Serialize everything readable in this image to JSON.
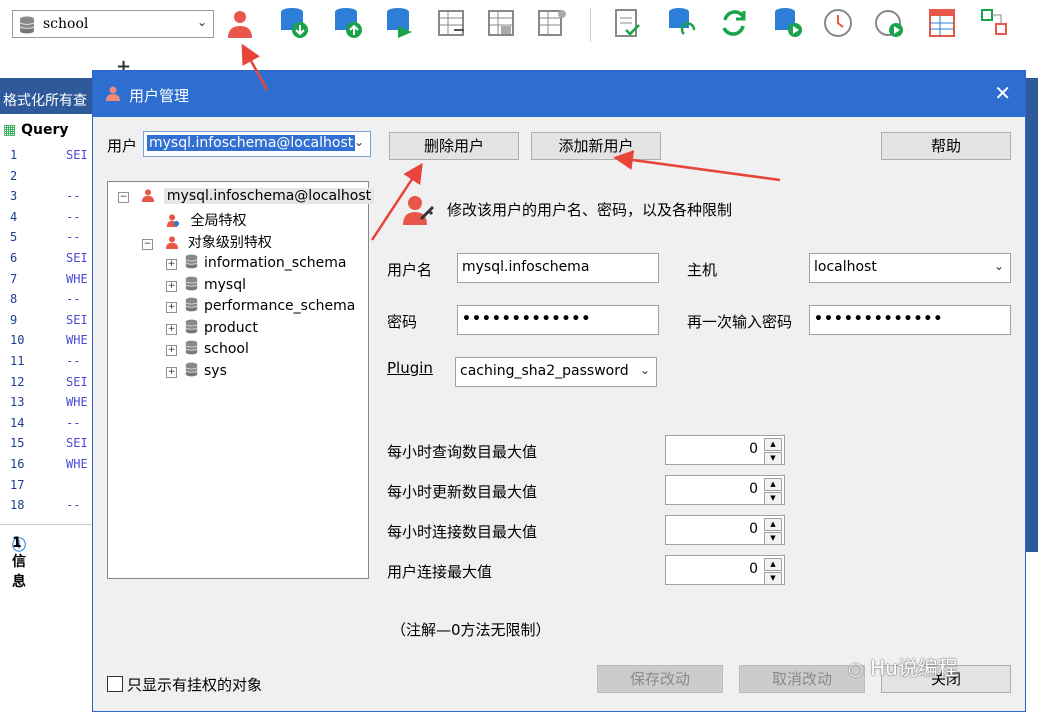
{
  "toolbar": {
    "db_select": "school"
  },
  "editor": {
    "tab_partial": "格式化所有查",
    "query_tab": "Query",
    "line_numbers": [
      "1",
      "2",
      "3",
      "4",
      "5",
      "6",
      "7",
      "8",
      "9",
      "10",
      "11",
      "12",
      "13",
      "14",
      "15",
      "16",
      "17",
      "18"
    ],
    "code": [
      "SEI",
      "",
      "--",
      "--",
      "--",
      "SEI",
      "WHE",
      "--",
      "SEI",
      "WHE",
      "--",
      "SEI",
      "WHE",
      "--",
      "SEI",
      "WHE",
      "",
      "--"
    ],
    "info_tab": "1 信息"
  },
  "dialog": {
    "title": "用户管理",
    "user_label": "用户",
    "user_value": "mysql.infoschema@localhost",
    "delete_button": "删除用户",
    "add_button": "添加新用户",
    "help_button": "帮助",
    "tree": {
      "root": "mysql.infoschema@localhost",
      "global": "全局特权",
      "object_level": "对象级别特权",
      "databases": [
        "information_schema",
        "mysql",
        "performance_schema",
        "product",
        "school",
        "sys"
      ]
    },
    "hint": "修改该用户的用户名、密码，以及各种限制",
    "username_label": "用户名",
    "username_value": "mysql.infoschema",
    "host_label": "主机",
    "host_value": "localhost",
    "password_label": "密码",
    "password_value": "•••••••••••••",
    "repeat_password_label": "再一次输入密码",
    "repeat_password_value": "•••••••••••••",
    "plugin_label": "Plugin",
    "plugin_value": "caching_sha2_password",
    "limits": [
      {
        "label": "每小时查询数目最大值",
        "value": "0"
      },
      {
        "label": "每小时更新数目最大值",
        "value": "0"
      },
      {
        "label": "每小时连接数目最大值",
        "value": "0"
      },
      {
        "label": "用户连接最大值",
        "value": "0"
      }
    ],
    "note": "（注解—0方法无限制）",
    "checkbox_label": "只显示有挂权的对象",
    "save_button": "保存改动",
    "cancel_button": "取消改动",
    "close_button": "关闭"
  },
  "watermark": "Hu说编程",
  "colors": {
    "titlebar": "#2f6ed1",
    "arrow": "#e8443a",
    "selection": "#3370d4"
  }
}
